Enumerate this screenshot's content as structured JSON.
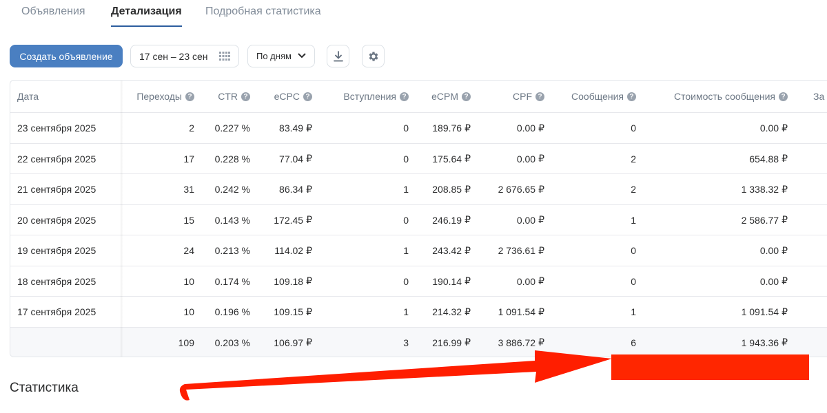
{
  "tabs": [
    {
      "label": "Объявления",
      "active": false
    },
    {
      "label": "Детализация",
      "active": true
    },
    {
      "label": "Подробная статистика",
      "active": false
    }
  ],
  "toolbar": {
    "create_label": "Создать объявление",
    "date_range": "17 сен – 23 сен",
    "period": "По дням",
    "download_icon": "download-icon",
    "settings_icon": "gear-icon"
  },
  "table": {
    "columns": [
      "Дата",
      "Переходы",
      "CTR",
      "eCPC",
      "Вступления",
      "eCPM",
      "CPF",
      "Сообщения",
      "Стоимость сообщения",
      "За"
    ],
    "currency": "₽",
    "rows": [
      {
        "date": "23 сентября 2025",
        "clicks": "2",
        "ctr": "0.227 %",
        "ecpc": "83.49",
        "joins": "0",
        "ecpm": "189.76",
        "cpf": "0.00",
        "messages": "0",
        "msg_cost": "0.00"
      },
      {
        "date": "22 сентября 2025",
        "clicks": "17",
        "ctr": "0.228 %",
        "ecpc": "77.04",
        "joins": "0",
        "ecpm": "175.64",
        "cpf": "0.00",
        "messages": "2",
        "msg_cost": "654.88"
      },
      {
        "date": "21 сентября 2025",
        "clicks": "31",
        "ctr": "0.242 %",
        "ecpc": "86.34",
        "joins": "1",
        "ecpm": "208.85",
        "cpf": "2 676.65",
        "messages": "2",
        "msg_cost": "1 338.32"
      },
      {
        "date": "20 сентября 2025",
        "clicks": "15",
        "ctr": "0.143 %",
        "ecpc": "172.45",
        "joins": "0",
        "ecpm": "246.19",
        "cpf": "0.00",
        "messages": "1",
        "msg_cost": "2 586.77"
      },
      {
        "date": "19 сентября 2025",
        "clicks": "24",
        "ctr": "0.213 %",
        "ecpc": "114.02",
        "joins": "1",
        "ecpm": "243.42",
        "cpf": "2 736.61",
        "messages": "0",
        "msg_cost": "0.00"
      },
      {
        "date": "18 сентября 2025",
        "clicks": "10",
        "ctr": "0.174 %",
        "ecpc": "109.18",
        "joins": "0",
        "ecpm": "190.14",
        "cpf": "0.00",
        "messages": "0",
        "msg_cost": "0.00"
      },
      {
        "date": "17 сентября 2025",
        "clicks": "10",
        "ctr": "0.196 %",
        "ecpc": "109.15",
        "joins": "1",
        "ecpm": "214.32",
        "cpf": "1 091.54",
        "messages": "1",
        "msg_cost": "1 091.54"
      }
    ],
    "total": {
      "date": "",
      "clicks": "109",
      "ctr": "0.203 %",
      "ecpc": "106.97",
      "joins": "3",
      "ecpm": "216.99",
      "cpf": "3 886.72",
      "messages": "6",
      "msg_cost": "1 943.36"
    }
  },
  "section_title": "Статистика",
  "annotation": {
    "arrow_color": "#ff1e00",
    "box_color": "#ff2600"
  }
}
